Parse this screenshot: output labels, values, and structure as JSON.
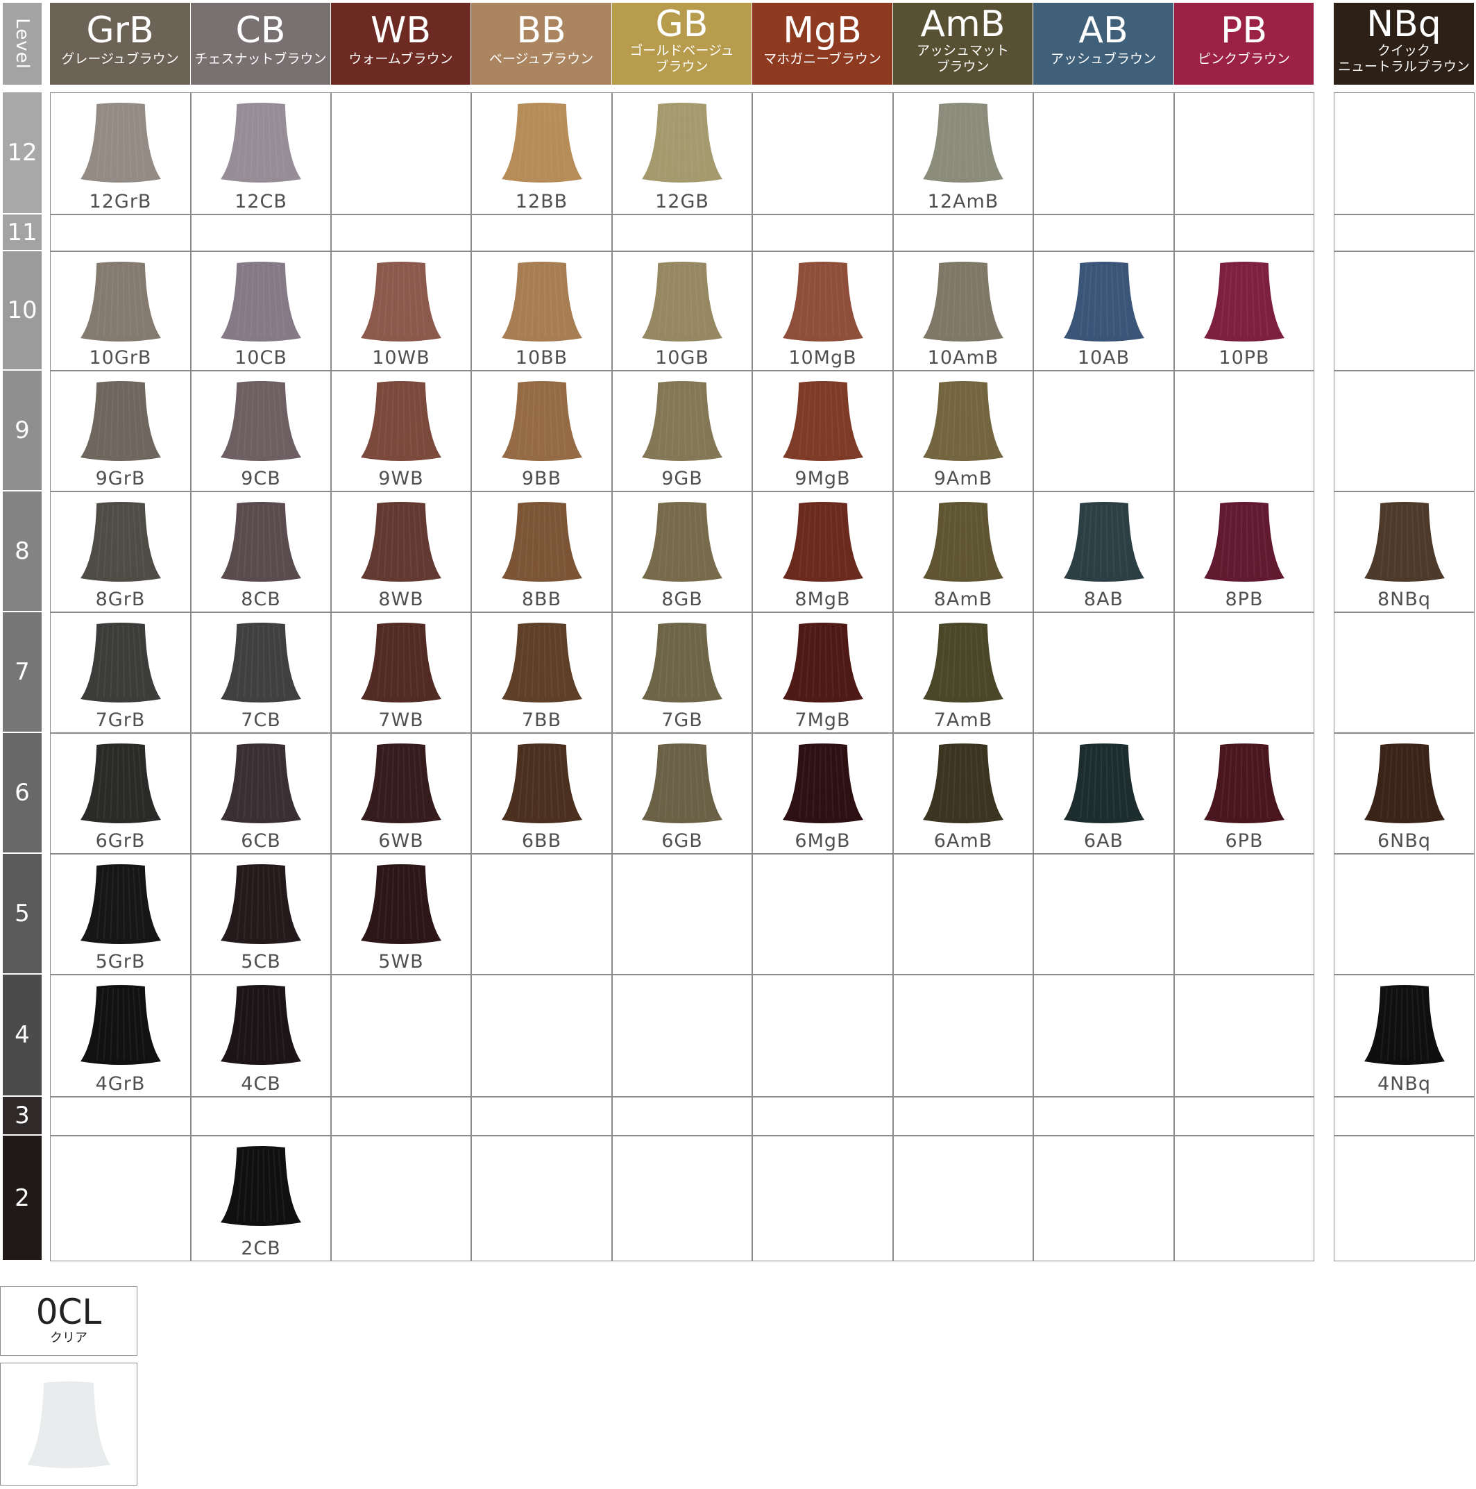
{
  "level_header": "Level",
  "levels": [
    {
      "label": "12",
      "color": "#a8a8a8"
    },
    {
      "label": "11",
      "color": "#a3a3a3"
    },
    {
      "label": "10",
      "color": "#9b9b9b"
    },
    {
      "label": "9",
      "color": "#8f8f8f"
    },
    {
      "label": "8",
      "color": "#838383"
    },
    {
      "label": "7",
      "color": "#767676"
    },
    {
      "label": "6",
      "color": "#686868"
    },
    {
      "label": "5",
      "color": "#5a5a5a"
    },
    {
      "label": "4",
      "color": "#4b4b4b"
    },
    {
      "label": "3",
      "color": "#2f2a29"
    },
    {
      "label": "2",
      "color": "#211918"
    }
  ],
  "columns": [
    {
      "code": "GrB",
      "name_lines": [
        "グレージュブラウン"
      ],
      "color": "#6c6256"
    },
    {
      "code": "CB",
      "name_lines": [
        "チェスナットブラウン"
      ],
      "color": "#797071"
    },
    {
      "code": "WB",
      "name_lines": [
        "ウォームブラウン"
      ],
      "color": "#6c2a22"
    },
    {
      "code": "BB",
      "name_lines": [
        "ベージュブラウン"
      ],
      "color": "#ab8560"
    },
    {
      "code": "GB",
      "name_lines": [
        "ゴールドベージュ",
        "ブラウン"
      ],
      "color": "#b69c4c"
    },
    {
      "code": "MgB",
      "name_lines": [
        "マホガニーブラウン"
      ],
      "color": "#8e3a20"
    },
    {
      "code": "AmB",
      "name_lines": [
        "アッシュマット",
        "ブラウン"
      ],
      "color": "#575032"
    },
    {
      "code": "AB",
      "name_lines": [
        "アッシュブラウン"
      ],
      "color": "#40607a"
    },
    {
      "code": "PB",
      "name_lines": [
        "ピンクブラウン"
      ],
      "color": "#9c2245"
    },
    {
      "code": "NBq",
      "name_lines": [
        "クイック",
        "ニュートラルブラウン"
      ],
      "color": "#2c2017"
    }
  ],
  "swatches": [
    {
      "level": 0,
      "col": 0,
      "label": "12GrB",
      "color": "#948c84"
    },
    {
      "level": 0,
      "col": 1,
      "label": "12CB",
      "color": "#978d97"
    },
    {
      "level": 0,
      "col": 3,
      "label": "12BB",
      "color": "#b68c58"
    },
    {
      "level": 0,
      "col": 4,
      "label": "12GB",
      "color": "#a49a6e"
    },
    {
      "level": 0,
      "col": 6,
      "label": "12AmB",
      "color": "#8c8c7c"
    },
    {
      "level": 2,
      "col": 0,
      "label": "10GrB",
      "color": "#857a70"
    },
    {
      "level": 2,
      "col": 1,
      "label": "10CB",
      "color": "#857a85"
    },
    {
      "level": 2,
      "col": 2,
      "label": "10WB",
      "color": "#8c5a4c"
    },
    {
      "level": 2,
      "col": 3,
      "label": "10BB",
      "color": "#a77d54"
    },
    {
      "level": 2,
      "col": 4,
      "label": "10GB",
      "color": "#958862"
    },
    {
      "level": 2,
      "col": 5,
      "label": "10MgB",
      "color": "#8e4e3a"
    },
    {
      "level": 2,
      "col": 6,
      "label": "10AmB",
      "color": "#7f7866"
    },
    {
      "level": 2,
      "col": 7,
      "label": "10AB",
      "color": "#3b5578"
    },
    {
      "level": 2,
      "col": 8,
      "label": "10PB",
      "color": "#7d1f3f"
    },
    {
      "level": 3,
      "col": 0,
      "label": "9GrB",
      "color": "#6f675d"
    },
    {
      "level": 3,
      "col": 1,
      "label": "9CB",
      "color": "#6d5f62"
    },
    {
      "level": 3,
      "col": 2,
      "label": "9WB",
      "color": "#7b4a3c"
    },
    {
      "level": 3,
      "col": 3,
      "label": "9BB",
      "color": "#946b44"
    },
    {
      "level": 3,
      "col": 4,
      "label": "9GB",
      "color": "#837755"
    },
    {
      "level": 3,
      "col": 5,
      "label": "9MgB",
      "color": "#7e3b28"
    },
    {
      "level": 3,
      "col": 6,
      "label": "9AmB",
      "color": "#73653f"
    },
    {
      "level": 4,
      "col": 0,
      "label": "8GrB",
      "color": "#4f4c46"
    },
    {
      "level": 4,
      "col": 1,
      "label": "8CB",
      "color": "#5a4c4e"
    },
    {
      "level": 4,
      "col": 2,
      "label": "8WB",
      "color": "#633a31"
    },
    {
      "level": 4,
      "col": 3,
      "label": "8BB",
      "color": "#7b5535"
    },
    {
      "level": 4,
      "col": 4,
      "label": "8GB",
      "color": "#786b4c"
    },
    {
      "level": 4,
      "col": 5,
      "label": "8MgB",
      "color": "#6a2a1e"
    },
    {
      "level": 4,
      "col": 6,
      "label": "8AmB",
      "color": "#5f5533"
    },
    {
      "level": 4,
      "col": 7,
      "label": "8AB",
      "color": "#2b3f45"
    },
    {
      "level": 4,
      "col": 8,
      "label": "8PB",
      "color": "#621a31"
    },
    {
      "level": 4,
      "col": 9,
      "label": "8NBq",
      "color": "#4d3a2a"
    },
    {
      "level": 5,
      "col": 0,
      "label": "7GrB",
      "color": "#3c3c3a"
    },
    {
      "level": 5,
      "col": 1,
      "label": "7CB",
      "color": "#404040"
    },
    {
      "level": 5,
      "col": 2,
      "label": "7WB",
      "color": "#512b24"
    },
    {
      "level": 5,
      "col": 3,
      "label": "7BB",
      "color": "#5e3f28"
    },
    {
      "level": 5,
      "col": 4,
      "label": "7GB",
      "color": "#6e6548"
    },
    {
      "level": 5,
      "col": 5,
      "label": "7MgB",
      "color": "#4f1a16"
    },
    {
      "level": 5,
      "col": 6,
      "label": "7AmB",
      "color": "#4a4628"
    },
    {
      "level": 6,
      "col": 0,
      "label": "6GrB",
      "color": "#2a2a29"
    },
    {
      "level": 6,
      "col": 1,
      "label": "6CB",
      "color": "#3a2f33"
    },
    {
      "level": 6,
      "col": 2,
      "label": "6WB",
      "color": "#361c1c"
    },
    {
      "level": 6,
      "col": 3,
      "label": "6BB",
      "color": "#4b3020"
    },
    {
      "level": 6,
      "col": 4,
      "label": "6GB",
      "color": "#6a6147"
    },
    {
      "level": 6,
      "col": 5,
      "label": "6MgB",
      "color": "#2c1012"
    },
    {
      "level": 6,
      "col": 6,
      "label": "6AmB",
      "color": "#3a3420"
    },
    {
      "level": 6,
      "col": 7,
      "label": "6AB",
      "color": "#1d2d2e"
    },
    {
      "level": 6,
      "col": 8,
      "label": "6PB",
      "color": "#4a161e"
    },
    {
      "level": 6,
      "col": 9,
      "label": "6NBq",
      "color": "#3a2318"
    },
    {
      "level": 7,
      "col": 0,
      "label": "5GrB",
      "color": "#161616"
    },
    {
      "level": 7,
      "col": 1,
      "label": "5CB",
      "color": "#241a1c"
    },
    {
      "level": 7,
      "col": 2,
      "label": "5WB",
      "color": "#2c1618"
    },
    {
      "level": 8,
      "col": 0,
      "label": "4GrB",
      "color": "#111111"
    },
    {
      "level": 8,
      "col": 1,
      "label": "4CB",
      "color": "#1c1416"
    },
    {
      "level": 8,
      "col": 9,
      "label": "4NBq",
      "color": "#0f0f10"
    },
    {
      "level": 10,
      "col": 1,
      "label": "2CB",
      "color": "#101010"
    }
  ],
  "clear": {
    "code": "0CL",
    "name": "クリア",
    "color": "#e8ecec"
  }
}
